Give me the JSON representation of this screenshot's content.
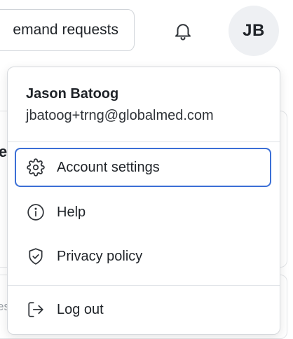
{
  "header": {
    "demand_requests_label": "emand requests",
    "avatar_initials": "JB"
  },
  "background": {
    "heading_fragment": "e",
    "text_fragment": "es"
  },
  "account_menu": {
    "user_name": "Jason Batoog",
    "user_email": "jbatoog+trng@globalmed.com",
    "items": [
      {
        "label": "Account settings",
        "icon": "gear-icon"
      },
      {
        "label": "Help",
        "icon": "info-icon"
      },
      {
        "label": "Privacy policy",
        "icon": "shield-check-icon"
      }
    ],
    "logout_label": "Log out",
    "accent_color": "#3b6fd6"
  }
}
